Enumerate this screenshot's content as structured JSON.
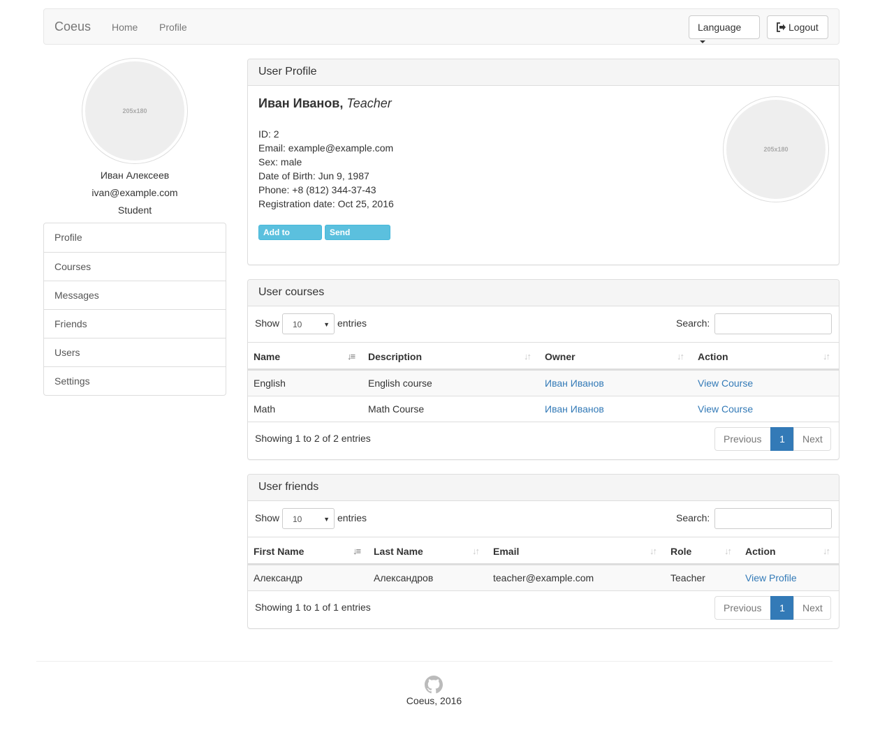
{
  "navbar": {
    "brand": "Coeus",
    "links": [
      "Home",
      "Profile"
    ],
    "language_label": "Language",
    "logout_label": "Logout"
  },
  "sidebar": {
    "avatar_placeholder": "205x180",
    "name": "Иван Алексеев",
    "email": "ivan@example.com",
    "role": "Student",
    "menu": [
      "Profile",
      "Courses",
      "Messages",
      "Friends",
      "Users",
      "Settings"
    ]
  },
  "profile": {
    "heading": "User Profile",
    "name": "Иван Иванов,",
    "role": "Teacher",
    "avatar_placeholder": "205x180",
    "details": [
      "ID: 2",
      "Email: example@example.com",
      "Sex: male",
      "Date of Birth: Jun 9, 1987",
      "Phone: +8 (812) 344-37-43",
      "Registration date: Oct 25, 2016"
    ],
    "add_friend_label": "Add to Friends",
    "send_message_label": "Send Message"
  },
  "courses": {
    "heading": "User courses",
    "show_label": "Show",
    "entries_value": "10",
    "entries_label": "entries",
    "search_label": "Search:",
    "columns": [
      "Name",
      "Description",
      "Owner",
      "Action"
    ],
    "rows": [
      {
        "name": "English",
        "description": "English course",
        "owner": "Иван Иванов",
        "action": "View Course"
      },
      {
        "name": "Math",
        "description": "Math Course",
        "owner": "Иван Иванов",
        "action": "View Course"
      }
    ],
    "info": "Showing 1 to 2 of 2 entries",
    "previous": "Previous",
    "page": "1",
    "next": "Next"
  },
  "friends": {
    "heading": "User friends",
    "show_label": "Show",
    "entries_value": "10",
    "entries_label": "entries",
    "search_label": "Search:",
    "columns": [
      "First Name",
      "Last Name",
      "Email",
      "Role",
      "Action"
    ],
    "rows": [
      {
        "first_name": "Александр",
        "last_name": "Александров",
        "email": "teacher@example.com",
        "role": "Teacher",
        "action": "View Profile"
      }
    ],
    "info": "Showing 1 to 1 of 1 entries",
    "previous": "Previous",
    "page": "1",
    "next": "Next"
  },
  "footer": {
    "icon": "github-icon",
    "text": "Coeus, 2016"
  },
  "colors": {
    "link": "#337ab7",
    "info_button": "#5bc0de",
    "active_page": "#337ab7"
  }
}
